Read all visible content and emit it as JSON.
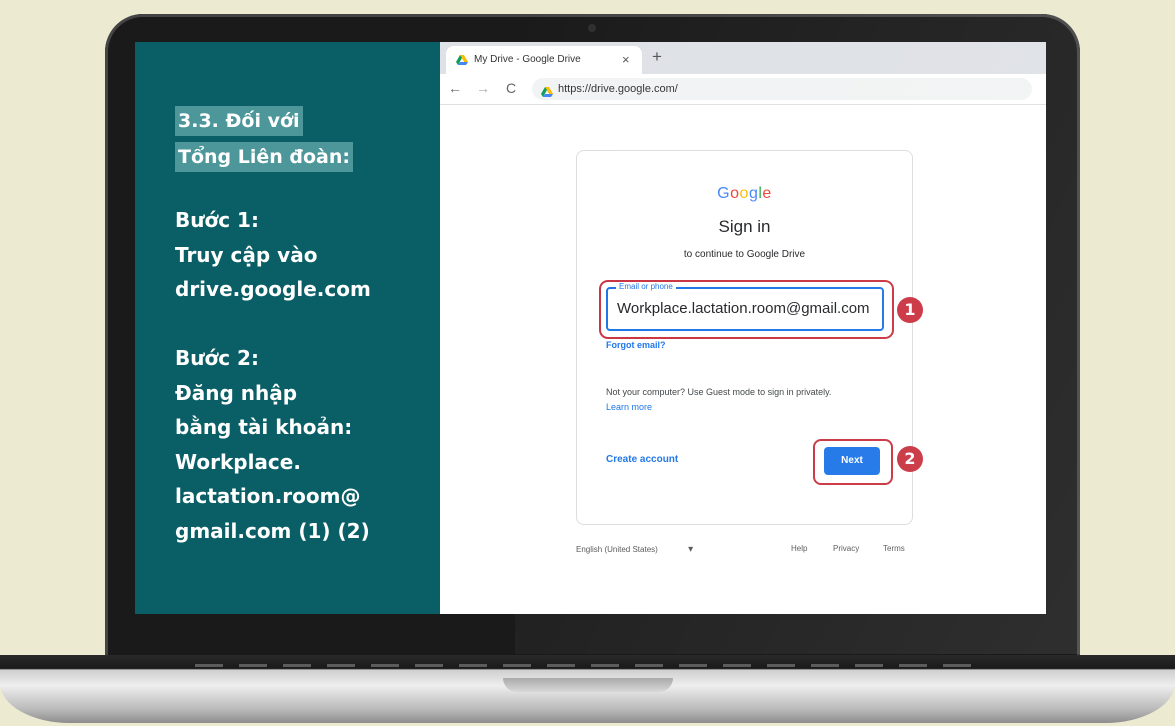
{
  "panel": {
    "heading_line1": "3.3. Đối với",
    "heading_line2": "Tổng Liên đoàn:",
    "step1_title": "Bước 1:",
    "step1_line1": "Truy cập vào",
    "step1_line2": "drive.google.com",
    "step2_title": "Bước 2:",
    "step2_line1": "Đăng nhập",
    "step2_line2": "bằng tài khoản:",
    "step2_line3": "Workplace.",
    "step2_line4": "lactation.room@",
    "step2_line5": "gmail.com (1) (2)"
  },
  "browser": {
    "tab_title": "My Drive - Google Drive",
    "tab_close": "×",
    "new_tab": "+",
    "back": "←",
    "forward": "→",
    "reload": "C",
    "url": "https://drive.google.com/"
  },
  "signin": {
    "logo": [
      "G",
      "o",
      "o",
      "g",
      "l",
      "e"
    ],
    "logo_colors": [
      "#4285F4",
      "#EA4335",
      "#FBBC05",
      "#4285F4",
      "#34A853",
      "#EA4335"
    ],
    "title": "Sign in",
    "subtitle": "to continue to Google Drive",
    "email_label": "Email or phone",
    "email_value": "Workplace.lactation.room@gmail.com",
    "forgot": "Forgot email?",
    "guest_text": "Not your computer? Use Guest mode to sign in privately.",
    "learn_more": "Learn more",
    "create_account": "Create account",
    "next": "Next"
  },
  "badges": {
    "one": "1",
    "two": "2"
  },
  "footer": {
    "language": "English (United States)",
    "dropdown_arrow": "▾",
    "help": "Help",
    "privacy": "Privacy",
    "terms": "Terms"
  },
  "colors": {
    "panel_bg": "#0a5f66",
    "highlight_bg": "#4d979b",
    "annotation_red": "#c9303e",
    "google_blue": "#1a73e8"
  }
}
